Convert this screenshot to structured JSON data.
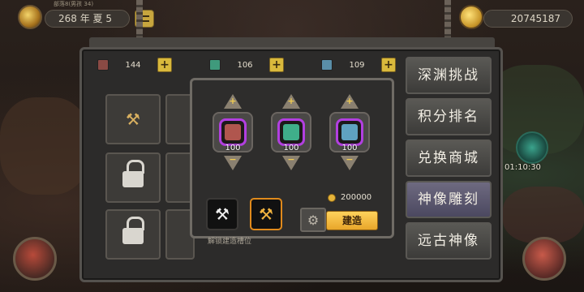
{
  "header": {
    "date_label": "268 年 夏 5",
    "date_sub": "部落8(男孩 34)",
    "gold": "20745187"
  },
  "resources": [
    {
      "value": "144",
      "color": "#8a4a44",
      "plus": "+"
    },
    {
      "value": "106",
      "color": "#3f9a7c",
      "plus": "+"
    },
    {
      "value": "109",
      "color": "#5a8ea8",
      "plus": "+"
    }
  ],
  "slots": [
    {
      "icon": "hammer-icon",
      "glyph": "⚒"
    },
    {
      "icon": "lock-icon"
    },
    {
      "icon": "lock-icon"
    }
  ],
  "popup": {
    "gems": [
      {
        "count": "100",
        "color": "#b0564e",
        "up": "+",
        "down": "−"
      },
      {
        "count": "100",
        "color": "#3fae8a",
        "up": "+",
        "down": "−"
      },
      {
        "count": "100",
        "color": "#5fa2c0",
        "up": "+",
        "down": "−"
      }
    ],
    "cost": "200000",
    "build_label": "建造",
    "bottom_hint": "解锁建造槽位",
    "tool_white_glyph": "⚒",
    "tool_gold_glyph": "⚒",
    "machine_glyph": "⚙"
  },
  "side_menu": [
    {
      "label": "深渊挑战"
    },
    {
      "label": "积分排名"
    },
    {
      "label": "兑换商城"
    },
    {
      "label": "神像雕刻"
    },
    {
      "label": "远古神像"
    }
  ],
  "timer": "01:10:30"
}
